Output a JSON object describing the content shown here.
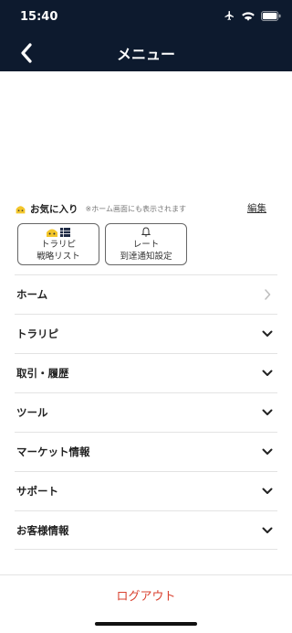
{
  "status_bar": {
    "time": "15:40",
    "icons": [
      "airplane-icon",
      "wifi-icon",
      "battery-icon"
    ]
  },
  "nav": {
    "title": "メニュー",
    "back_icon": "chevron-left-icon"
  },
  "favorites": {
    "title": "お気に入り",
    "note": "※ホーム画面にも表示されます",
    "edit_label": "編集",
    "cards": [
      {
        "line1": "トラリピ",
        "line2": "戦略リスト",
        "icon": "strategy-icon"
      },
      {
        "line1": "レート",
        "line2": "到達通知設定",
        "icon": "bell-icon"
      }
    ]
  },
  "menu": {
    "items": [
      {
        "label": "ホーム",
        "chevron": "chevron-right-icon"
      },
      {
        "label": "トラリピ",
        "chevron": "chevron-down-icon"
      },
      {
        "label": "取引・履歴",
        "chevron": "chevron-down-icon"
      },
      {
        "label": "ツール",
        "chevron": "chevron-down-icon"
      },
      {
        "label": "マーケット情報",
        "chevron": "chevron-down-icon"
      },
      {
        "label": "サポート",
        "chevron": "chevron-down-icon"
      },
      {
        "label": "お客様情報",
        "chevron": "chevron-down-icon"
      }
    ]
  },
  "logout_label": "ログアウト",
  "colors": {
    "header_bg": "#0d1a2e",
    "logout": "#d9412f",
    "divider": "#e3e3e3"
  }
}
